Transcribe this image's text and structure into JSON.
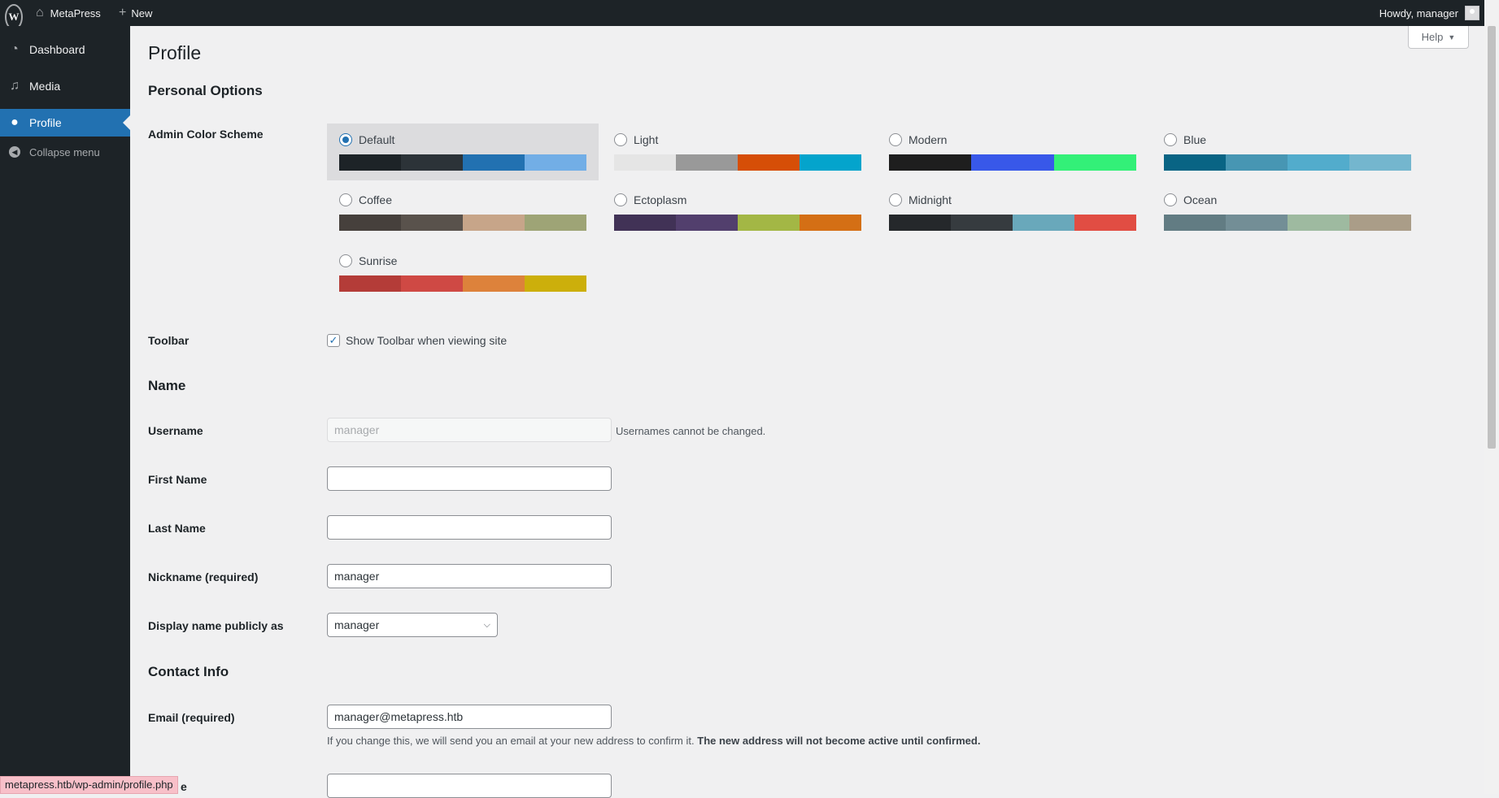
{
  "adminbar": {
    "site_name": "MetaPress",
    "new_label": "New",
    "howdy": "Howdy, manager",
    "icons": [
      "wordpress-logo",
      "home-icon",
      "plus-icon",
      "avatar"
    ]
  },
  "sidebar": {
    "items": [
      {
        "label": "Dashboard",
        "icon": "dashboard-icon"
      },
      {
        "label": "Media",
        "icon": "media-icon"
      },
      {
        "label": "Profile",
        "icon": "user-icon",
        "current": true
      },
      {
        "label": "Collapse menu",
        "icon": "collapse-icon"
      }
    ]
  },
  "help": {
    "label": "Help",
    "arrow": "▼"
  },
  "page": {
    "title": "Profile",
    "personal_options": "Personal Options",
    "color_scheme_label": "Admin Color Scheme",
    "schemes": [
      {
        "name": "Default",
        "selected": true,
        "colors": [
          "#1d2327",
          "#2c3338",
          "#2271b1",
          "#72aee6"
        ]
      },
      {
        "name": "Light",
        "colors": [
          "#e5e5e5",
          "#999999",
          "#d64e07",
          "#04a4cc"
        ]
      },
      {
        "name": "Modern",
        "colors": [
          "#1e1e1e",
          "#3858e9",
          "#33f078"
        ]
      },
      {
        "name": "Blue",
        "colors": [
          "#096484",
          "#4796b3",
          "#52accc",
          "#74b6ce"
        ]
      },
      {
        "name": "Coffee",
        "colors": [
          "#46403c",
          "#59524c",
          "#c7a589",
          "#9ea476"
        ]
      },
      {
        "name": "Ectoplasm",
        "colors": [
          "#413256",
          "#523f6d",
          "#a3b745",
          "#d46f15"
        ]
      },
      {
        "name": "Midnight",
        "colors": [
          "#25282b",
          "#363b3f",
          "#69a8bb",
          "#e14d43"
        ]
      },
      {
        "name": "Ocean",
        "colors": [
          "#627c83",
          "#738e96",
          "#9ebaa0",
          "#aa9d88"
        ]
      },
      {
        "name": "Sunrise",
        "colors": [
          "#b43c38",
          "#cf4944",
          "#dd823b",
          "#ccaf0b"
        ]
      }
    ],
    "toolbar_label": "Toolbar",
    "toolbar_checkbox": "Show Toolbar when viewing site",
    "toolbar_checked": "✓",
    "name_section": "Name",
    "username_label": "Username",
    "username_value": "manager",
    "username_note": "Usernames cannot be changed.",
    "first_name_label": "First Name",
    "first_name_value": "",
    "last_name_label": "Last Name",
    "last_name_value": "",
    "nickname_label": "Nickname (required)",
    "nickname_value": "manager",
    "display_name_label": "Display name publicly as",
    "display_name_value": "manager",
    "contact_section": "Contact Info",
    "email_label": "Email (required)",
    "email_value": "manager@metapress.htb",
    "email_note": "If you change this, we will send you an email at your new address to confirm it.",
    "email_note_bold": "The new address will not become active until confirmed.",
    "website_label_partial": "e",
    "website_value": ""
  },
  "statusbar": {
    "url": "metapress.htb/wp-admin/profile.php"
  }
}
